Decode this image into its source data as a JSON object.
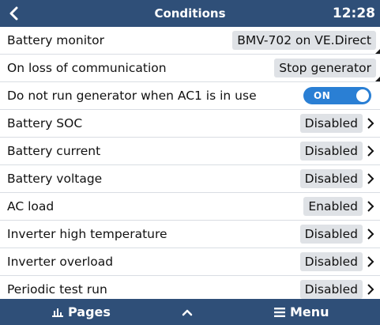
{
  "header": {
    "title": "Conditions",
    "time": "12:28",
    "back_icon": "chevron-left-icon"
  },
  "rows": [
    {
      "label": "Battery monitor",
      "value": "BMV-702 on VE.Direct",
      "kind": "select"
    },
    {
      "label": "On loss of communication",
      "value": "Stop generator",
      "kind": "select"
    },
    {
      "label": "Do not run generator when AC1 is in use",
      "value": "ON",
      "kind": "toggle",
      "state": true
    },
    {
      "label": "Battery SOC",
      "value": "Disabled",
      "kind": "submenu"
    },
    {
      "label": "Battery current",
      "value": "Disabled",
      "kind": "submenu"
    },
    {
      "label": "Battery voltage",
      "value": "Disabled",
      "kind": "submenu"
    },
    {
      "label": "AC load",
      "value": "Enabled",
      "kind": "submenu"
    },
    {
      "label": "Inverter high temperature",
      "value": "Disabled",
      "kind": "submenu"
    },
    {
      "label": "Inverter overload",
      "value": "Disabled",
      "kind": "submenu"
    },
    {
      "label": "Periodic test run",
      "value": "Disabled",
      "kind": "submenu"
    }
  ],
  "footer": {
    "pages_label": "Pages",
    "menu_label": "Menu",
    "pages_icon": "bar-chart-icon",
    "up_icon": "chevron-up-icon",
    "menu_icon": "hamburger-icon"
  },
  "colors": {
    "bar_background": "#2f4f78",
    "toggle_on": "#2a7fd4",
    "pill_background": "#dfe2e6"
  }
}
